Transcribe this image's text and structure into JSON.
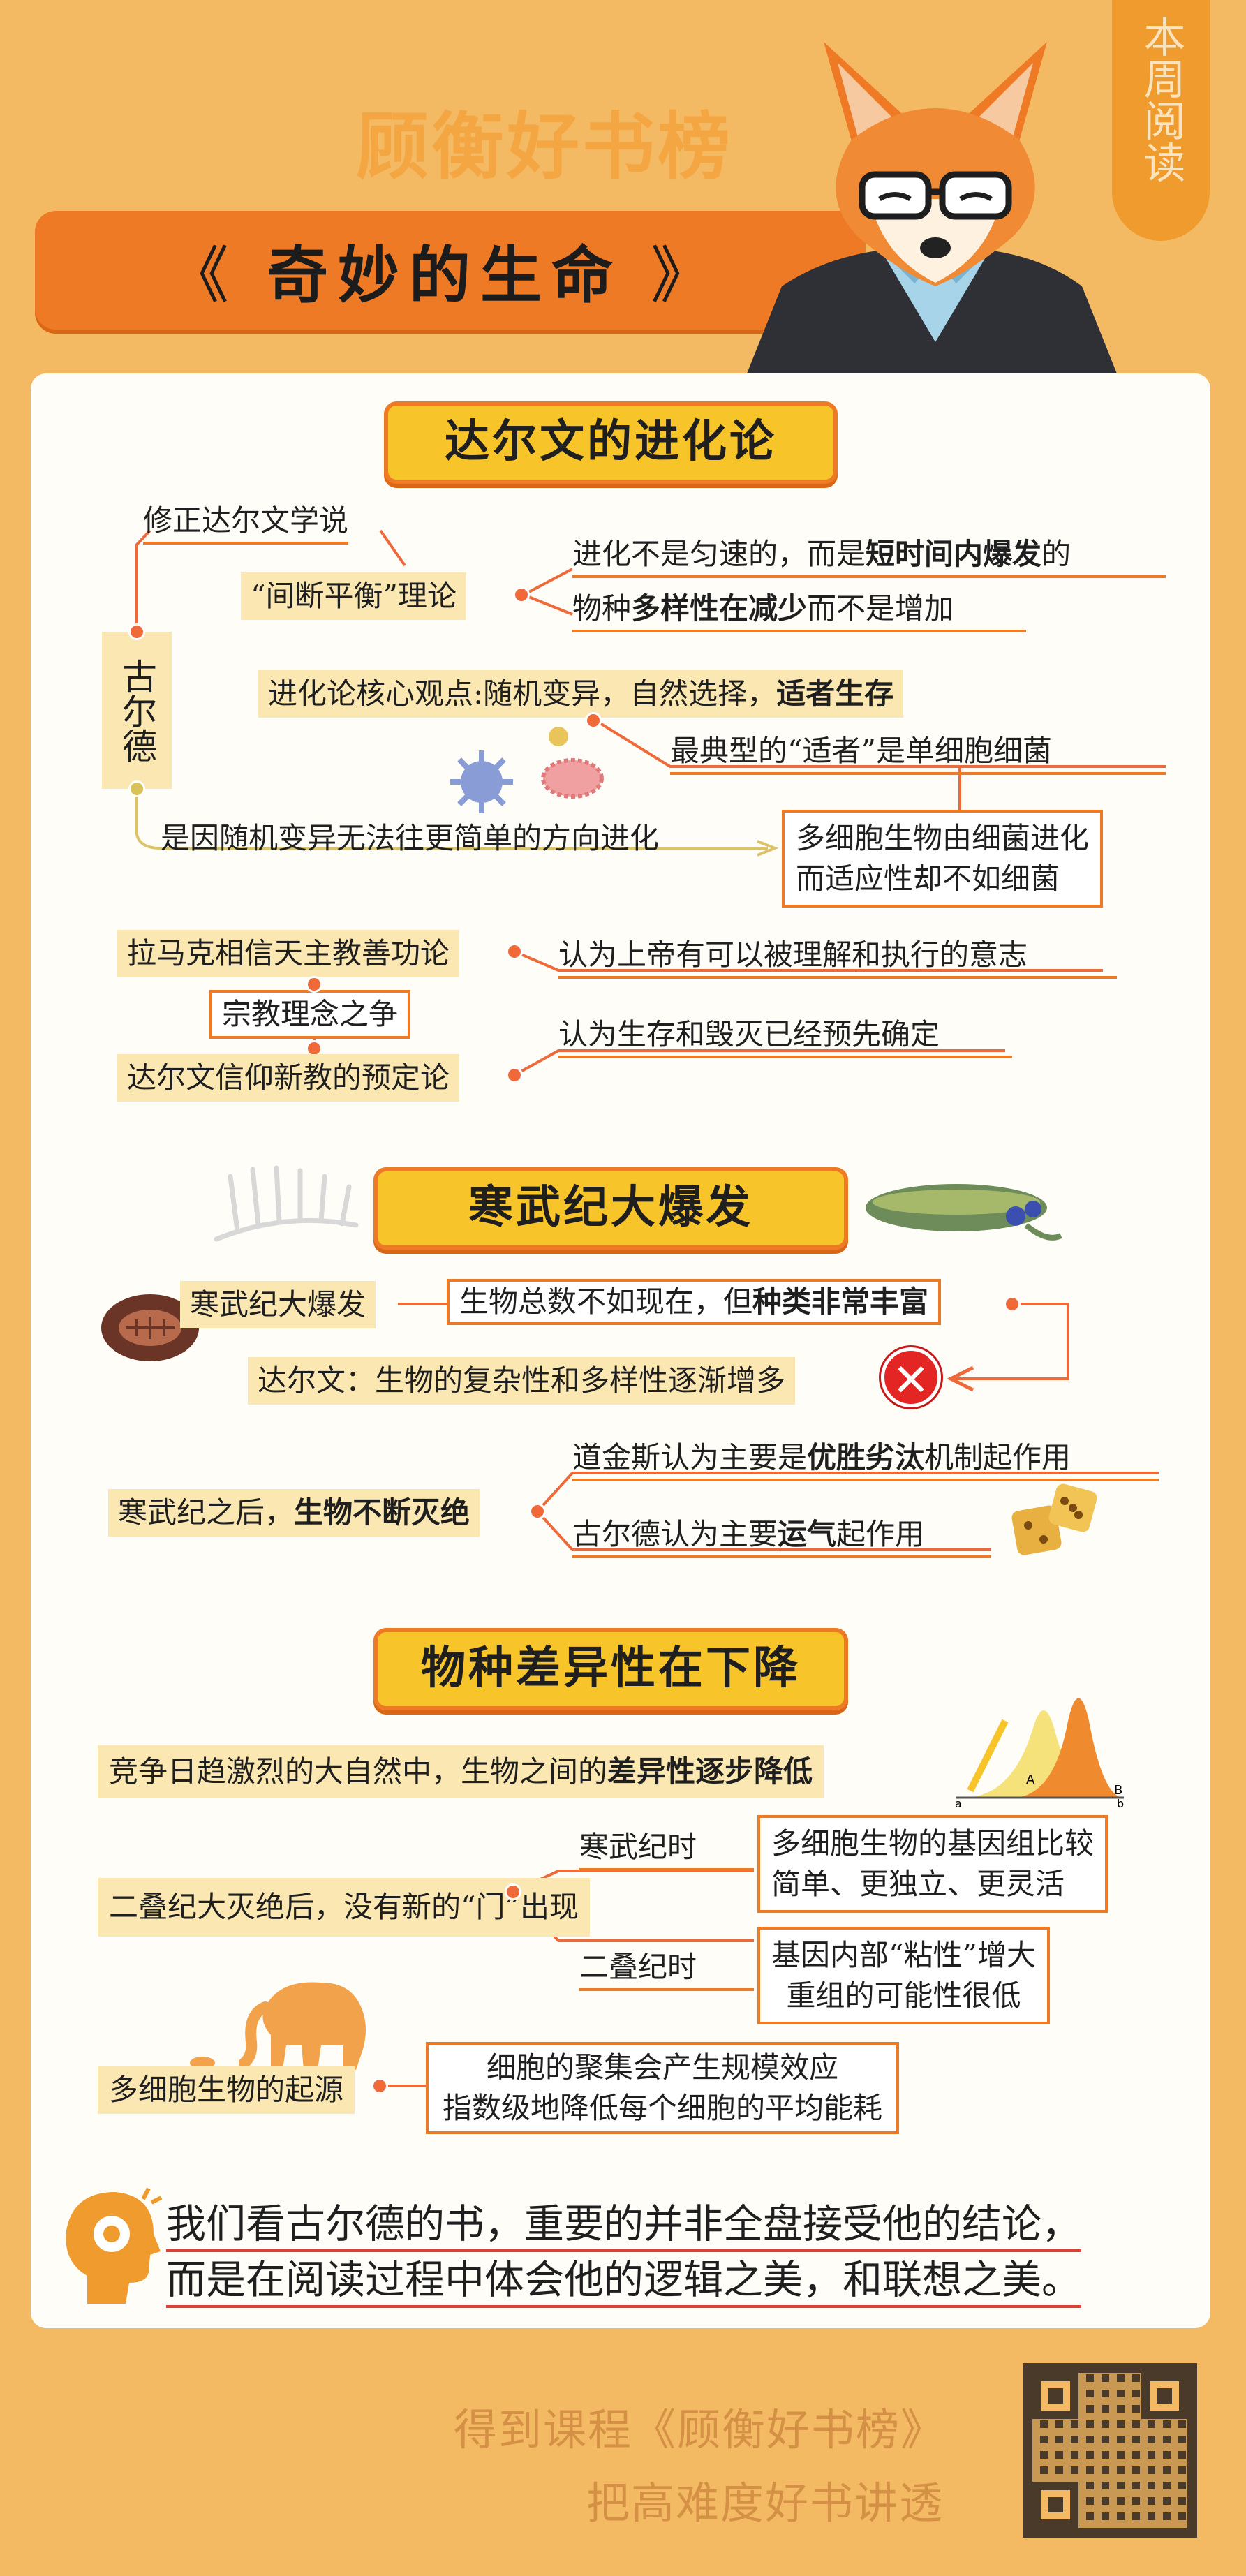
{
  "header": {
    "brand": "顾衡好书榜",
    "weekly_tag": "本周阅读",
    "book_title": "奇妙的生命",
    "title_left": "《",
    "title_right": "》"
  },
  "section1": {
    "heading": "达尔文的进化论",
    "person": "古尔德",
    "revise_label": "修正达尔文学说",
    "theory": "“间断平衡”理论",
    "theory_p1a": "进化不是匀速的，而是",
    "theory_p1b": "短时间内爆发",
    "theory_p1c": "的",
    "theory_p2a": "物种",
    "theory_p2b": "多样性在减少",
    "theory_p2c": "而不是增加",
    "core_a": "进化论核心观点:随机变异，自然选择，",
    "core_b": "适者生存",
    "fittest": "最典型的“适者”是单细胞细菌",
    "random": "是因随机变异无法往更简单的方向进化",
    "multicell_1": "多细胞生物由细菌进化",
    "multicell_2": "而适应性却不如细菌",
    "lamarck": "拉马克相信天主教善功论",
    "lamarck_note": "认为上帝有可以被理解和执行的意志",
    "religion": "宗教理念之争",
    "darwin_faith": "达尔文信仰新教的预定论",
    "darwin_note": "认为生存和毁灭已经预先确定"
  },
  "section2": {
    "heading": "寒武纪大爆发",
    "label": "寒武纪大爆发",
    "fact_a": "生物总数不如现在，但",
    "fact_b": "种类非常丰富",
    "darwin_claim": "达尔文：生物的复杂性和多样性逐渐增多",
    "wrong_mark": "✕",
    "after_a": "寒武纪之后，",
    "after_b": "生物不断灭绝",
    "dawkins_a": "道金斯认为主要是",
    "dawkins_b": "优胜劣汰",
    "dawkins_c": "机制起作用",
    "gould_a": "古尔德认为主要",
    "gould_b": "运气",
    "gould_c": "起作用"
  },
  "section3": {
    "heading": "物种差异性在下降",
    "compete_a": "竞争日趋激烈的大自然中，生物之间的",
    "compete_b": "差异性逐步降低",
    "permian": "二叠纪大灭绝后，没有新的“门”出现",
    "cambrian_time": "寒武纪时",
    "cambrian_box_1": "多细胞生物的基因组比较",
    "cambrian_box_2": "简单、更独立、更灵活",
    "permian_time": "二叠纪时",
    "permian_box_1": "基因内部“粘性”增大",
    "permian_box_2": "重组的可能性很低",
    "origin": "多细胞生物的起源",
    "origin_box_1": "细胞的聚集会产生规模效应",
    "origin_box_2": "指数级地降低每个细胞的平均能耗",
    "curve_labels": [
      "a",
      "A",
      "B",
      "b"
    ]
  },
  "conclusion": {
    "line1": "我们看古尔德的书，重要的并非全盘接受他的结论，",
    "line2": "而是在阅读过程中体会他的逻辑之美，和联想之美。"
  },
  "footer": {
    "course": "得到课程《顾衡好书榜》",
    "slogan": "把高难度好书讲透"
  },
  "colors": {
    "background": "#f4b963",
    "accent": "#ee7a25",
    "heading_fill": "#f7c42a",
    "highlight": "#fbe7b2"
  }
}
